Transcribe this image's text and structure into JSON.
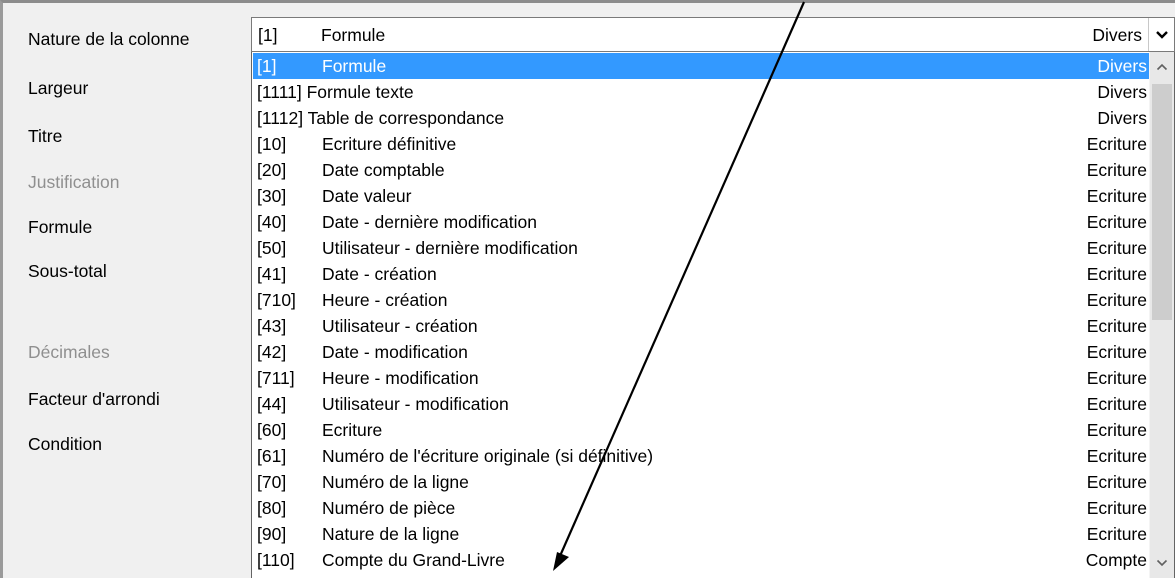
{
  "form": {
    "labels": {
      "nature": "Nature de la colonne",
      "largeur": "Largeur",
      "titre": "Titre",
      "justification": "Justification",
      "formule": "Formule",
      "sous_total": "Sous-total",
      "decimales": "Décimales",
      "facteur": "Facteur d'arrondi",
      "condition": "Condition"
    }
  },
  "combo": {
    "code": "[1]",
    "name": "Formule",
    "category": "Divers",
    "button_icon": "chevron-down-icon"
  },
  "list": {
    "selected_index": 0,
    "selection_color": "#3399ff",
    "items": [
      {
        "code": "[1]",
        "name": "Formule",
        "category": "Divers"
      },
      {
        "code": "[1111] Formule texte",
        "name": "",
        "category": "Divers"
      },
      {
        "code": "[1112] Table de correspondance",
        "name": "",
        "category": "Divers"
      },
      {
        "code": "[10]",
        "name": "Ecriture définitive",
        "category": "Ecriture"
      },
      {
        "code": "[20]",
        "name": "Date comptable",
        "category": "Ecriture"
      },
      {
        "code": "[30]",
        "name": "Date valeur",
        "category": "Ecriture"
      },
      {
        "code": "[40]",
        "name": "Date - dernière modification",
        "category": "Ecriture"
      },
      {
        "code": "[50]",
        "name": "Utilisateur - dernière modification",
        "category": "Ecriture"
      },
      {
        "code": "[41]",
        "name": "Date - création",
        "category": "Ecriture"
      },
      {
        "code": "[710]",
        "name": "Heure - création",
        "category": "Ecriture"
      },
      {
        "code": "[43]",
        "name": "Utilisateur - création",
        "category": "Ecriture"
      },
      {
        "code": "[42]",
        "name": "Date - modification",
        "category": "Ecriture"
      },
      {
        "code": "[711]",
        "name": "Heure - modification",
        "category": "Ecriture"
      },
      {
        "code": "[44]",
        "name": "Utilisateur - modification",
        "category": "Ecriture"
      },
      {
        "code": "[60]",
        "name": "Ecriture",
        "category": "Ecriture"
      },
      {
        "code": "[61]",
        "name": "Numéro de l'écriture originale (si définitive)",
        "category": "Ecriture"
      },
      {
        "code": "[70]",
        "name": "Numéro de la ligne",
        "category": "Ecriture"
      },
      {
        "code": "[80]",
        "name": "Numéro de pièce",
        "category": "Ecriture"
      },
      {
        "code": "[90]",
        "name": "Nature de la ligne",
        "category": "Ecriture"
      },
      {
        "code": "[110]",
        "name": "Compte du Grand-Livre",
        "category": "Compte"
      }
    ],
    "scroll_up_icon": "chevron-up-icon",
    "scroll_down_icon": "chevron-down-icon"
  },
  "annotation": {
    "icon": "arrow-icon",
    "color": "#000000"
  }
}
